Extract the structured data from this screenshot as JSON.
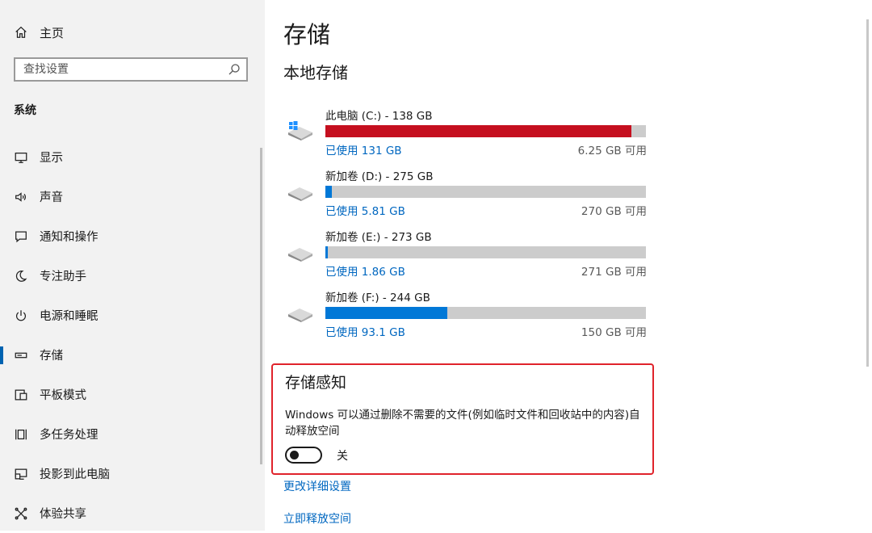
{
  "sidebar": {
    "home_label": "主页",
    "search_placeholder": "查找设置",
    "section_title": "系统",
    "items": [
      {
        "label": "显示",
        "icon": "monitor-icon"
      },
      {
        "label": "声音",
        "icon": "speaker-icon"
      },
      {
        "label": "通知和操作",
        "icon": "notification-icon"
      },
      {
        "label": "专注助手",
        "icon": "moon-icon"
      },
      {
        "label": "电源和睡眠",
        "icon": "power-icon"
      },
      {
        "label": "存储",
        "icon": "storage-icon",
        "active": true
      },
      {
        "label": "平板模式",
        "icon": "tablet-mode-icon"
      },
      {
        "label": "多任务处理",
        "icon": "multitasking-icon"
      },
      {
        "label": "投影到此电脑",
        "icon": "project-icon"
      },
      {
        "label": "体验共享",
        "icon": "share-icon"
      }
    ]
  },
  "main": {
    "title": "存储",
    "local_storage_title": "本地存储",
    "drives": [
      {
        "name": "此电脑 (C:) - 138 GB",
        "used": "已使用 131 GB",
        "free": "6.25 GB 可用",
        "used_fraction": 0.955,
        "color": "#c50f1f",
        "icon": "windows-drive-icon"
      },
      {
        "name": "新加卷 (D:) - 275 GB",
        "used": "已使用 5.81 GB",
        "free": "270 GB 可用",
        "used_fraction": 0.021,
        "color": "#0078d7",
        "icon": "drive-icon"
      },
      {
        "name": "新加卷 (E:) - 273 GB",
        "used": "已使用 1.86 GB",
        "free": "271 GB 可用",
        "used_fraction": 0.007,
        "color": "#0078d7",
        "icon": "drive-icon"
      },
      {
        "name": "新加卷 (F:) - 244 GB",
        "used": "已使用 93.1 GB",
        "free": "150 GB 可用",
        "used_fraction": 0.38,
        "color": "#0078d7",
        "icon": "drive-icon"
      }
    ],
    "storage_sense": {
      "title": "存储感知",
      "description": "Windows 可以通过删除不需要的文件(例如临时文件和回收站中的内容)自动释放空间",
      "toggle_state": "关",
      "highlight_color": "#e0232b"
    },
    "links": {
      "change_settings": "更改详细设置",
      "free_up_now": "立即释放空间"
    }
  }
}
